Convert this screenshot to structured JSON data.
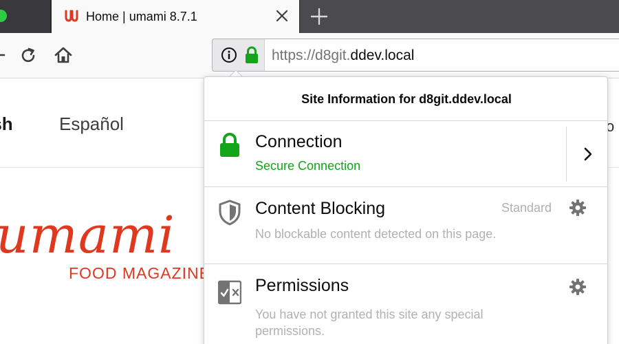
{
  "tab": {
    "title": "Home | umami 8.7.1"
  },
  "urlbar": {
    "scheme": "https://",
    "subdomain": "d8git.",
    "host": "ddev.local"
  },
  "page": {
    "language_active": "glish",
    "language_other": "Español",
    "right_cut_text": "vo",
    "logo_text": "umami",
    "logo_tagline": "FOOD MAGAZINE"
  },
  "popup": {
    "title": "Site Information for d8git.ddev.local",
    "connection": {
      "label": "Connection",
      "status": "Secure Connection"
    },
    "content_blocking": {
      "label": "Content Blocking",
      "level": "Standard",
      "description": "No blockable content detected on this page."
    },
    "permissions": {
      "label": "Permissions",
      "description_line1": "You have not granted this site any special",
      "description_line2": "permissions."
    }
  },
  "colors": {
    "secure_green": "#12a51a",
    "brand_red": "#e0381e",
    "tabstrip": "#4a4a4f"
  },
  "icons": {
    "favicon": "umami-favicon",
    "tab_close": "close-icon",
    "new_tab": "plus-icon",
    "reload": "reload-icon",
    "home": "home-icon",
    "info": "info-icon",
    "lock": "lock-icon",
    "shield": "shield-icon",
    "permissions": "permissions-icon",
    "gear": "gear-icon",
    "chevron": "chevron-right-icon"
  }
}
